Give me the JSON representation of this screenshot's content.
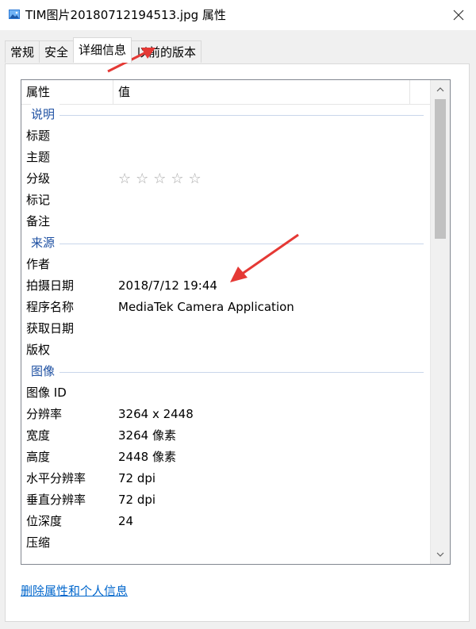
{
  "window": {
    "title": "TIM图片20180712194513.jpg 属性",
    "icon": "image-file-icon",
    "close_icon": "close-icon"
  },
  "tabs": [
    {
      "label": "常规",
      "active": false
    },
    {
      "label": "安全",
      "active": false
    },
    {
      "label": "详细信息",
      "active": true
    },
    {
      "label": "以前的版本",
      "active": false
    }
  ],
  "list": {
    "header": {
      "property": "属性",
      "value": "值"
    },
    "groups": {
      "description": {
        "label": "说明",
        "rows": [
          {
            "property": "标题",
            "value": ""
          },
          {
            "property": "主题",
            "value": ""
          },
          {
            "property": "分级",
            "value": "☆☆☆☆☆",
            "rating": 0
          },
          {
            "property": "标记",
            "value": ""
          },
          {
            "property": "备注",
            "value": ""
          }
        ]
      },
      "origin": {
        "label": "来源",
        "rows": [
          {
            "property": "作者",
            "value": ""
          },
          {
            "property": "拍摄日期",
            "value": "2018/7/12 19:44"
          },
          {
            "property": "程序名称",
            "value": "MediaTek Camera Application"
          },
          {
            "property": "获取日期",
            "value": ""
          },
          {
            "property": "版权",
            "value": ""
          }
        ]
      },
      "image": {
        "label": "图像",
        "rows": [
          {
            "property": "图像 ID",
            "value": ""
          },
          {
            "property": "分辨率",
            "value": "3264 x 2448"
          },
          {
            "property": "宽度",
            "value": "3264 像素"
          },
          {
            "property": "高度",
            "value": "2448 像素"
          },
          {
            "property": "水平分辨率",
            "value": "72 dpi"
          },
          {
            "property": "垂直分辨率",
            "value": "72 dpi"
          },
          {
            "property": "位深度",
            "value": "24"
          },
          {
            "property": "压缩",
            "value": ""
          }
        ]
      }
    },
    "scroll_up_icon": "chevron-up-icon",
    "scroll_down_icon": "chevron-down-icon"
  },
  "footer": {
    "remove_link": "删除属性和个人信息"
  },
  "colors": {
    "group_label": "#1e50a2",
    "link": "#0066cc",
    "annotation_arrow": "#e53935"
  }
}
